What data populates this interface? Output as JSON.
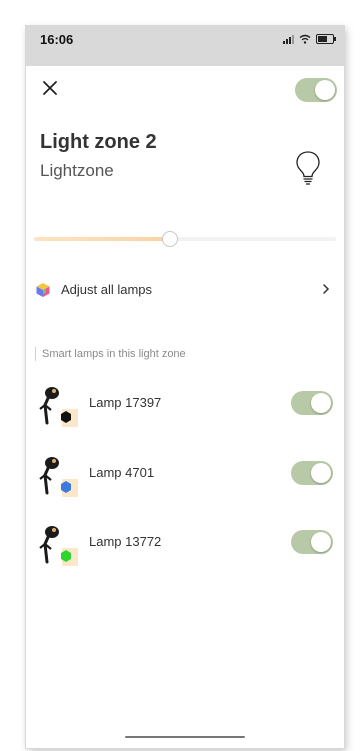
{
  "status_bar": {
    "time": "16:06"
  },
  "header": {
    "master_toggle_on": true
  },
  "zone": {
    "title": "Light zone 2",
    "subtitle": "Lightzone"
  },
  "brightness": {
    "level": 0.45
  },
  "adjust": {
    "label": "Adjust all lamps"
  },
  "section": {
    "label": "Smart lamps in this light zone"
  },
  "lamps": [
    {
      "label": "Lamp 17397",
      "color": "#111111",
      "on": true
    },
    {
      "label": "Lamp 4701",
      "color": "#3b7be0",
      "on": true
    },
    {
      "label": "Lamp 13772",
      "color": "#2fd52f",
      "on": true
    }
  ],
  "colors": {
    "toggle_on": "#b7c9a6",
    "accent_warm": "#f9d3a5"
  },
  "icons": {
    "close": "close-icon",
    "bulb": "lightbulb-icon",
    "adjust": "color-cube-icon",
    "chevron": "chevron-right-icon",
    "lamp": "garden-spotlight-icon"
  }
}
